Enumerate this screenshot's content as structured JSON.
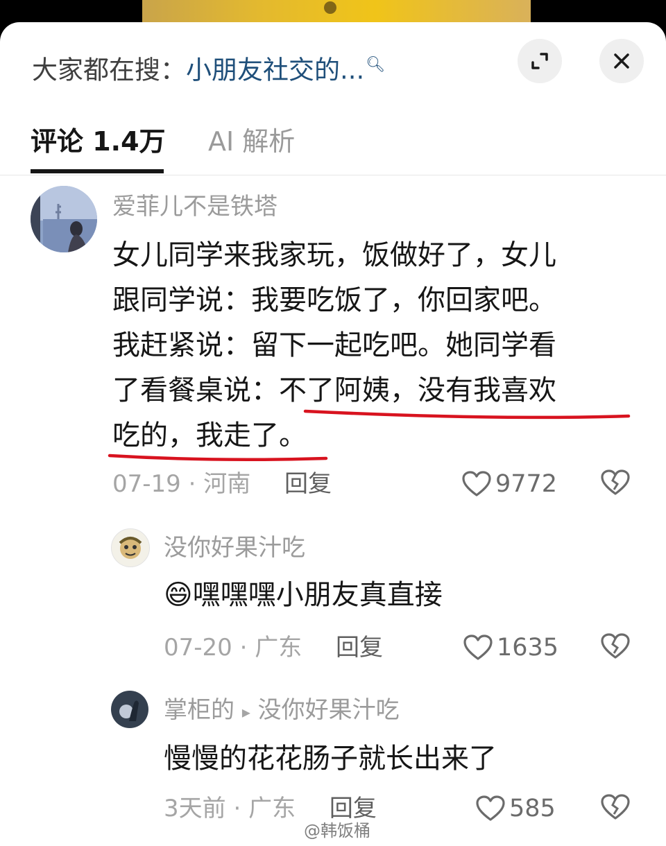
{
  "header": {
    "search_prefix": "大家都在搜：",
    "search_query": "小朋友社交的...",
    "search_icon": "search-icon",
    "expand_icon": "expand-icon",
    "close_icon": "close-icon"
  },
  "tabs": [
    {
      "label": "评论 1.4万",
      "active": true
    },
    {
      "label": "AI 解析",
      "active": false
    }
  ],
  "comments": [
    {
      "username": "爱菲儿不是铁塔",
      "text_lines": [
        "女儿同学来我家玩，饭做好了，女儿",
        "跟同学说：我要吃饭了，你回家吧。",
        "我赶紧说：留下一起吃吧。她同学看",
        "了看餐桌说：不了阿姨，没有我喜欢",
        "吃的，我走了。"
      ],
      "date": "07-19",
      "location": "河南",
      "reply_label": "回复",
      "likes": "9772"
    },
    {
      "username": "没你好果汁吃",
      "emoji": "😄",
      "text": "嘿嘿嘿小朋友真直接",
      "date": "07-20",
      "location": "广东",
      "reply_label": "回复",
      "likes": "1635"
    },
    {
      "username": "掌柜的",
      "reply_arrow": "▸",
      "reply_to": "没你好果汁吃",
      "text": "慢慢的花花肠子就长出来了",
      "date": "3天前",
      "location": "广东",
      "reply_label": "回复",
      "likes": "585"
    }
  ],
  "separator": "·",
  "watermark": "@韩饭桶",
  "colors": {
    "highlight_underline": "#d8131f",
    "query": "#1f4f7a"
  }
}
